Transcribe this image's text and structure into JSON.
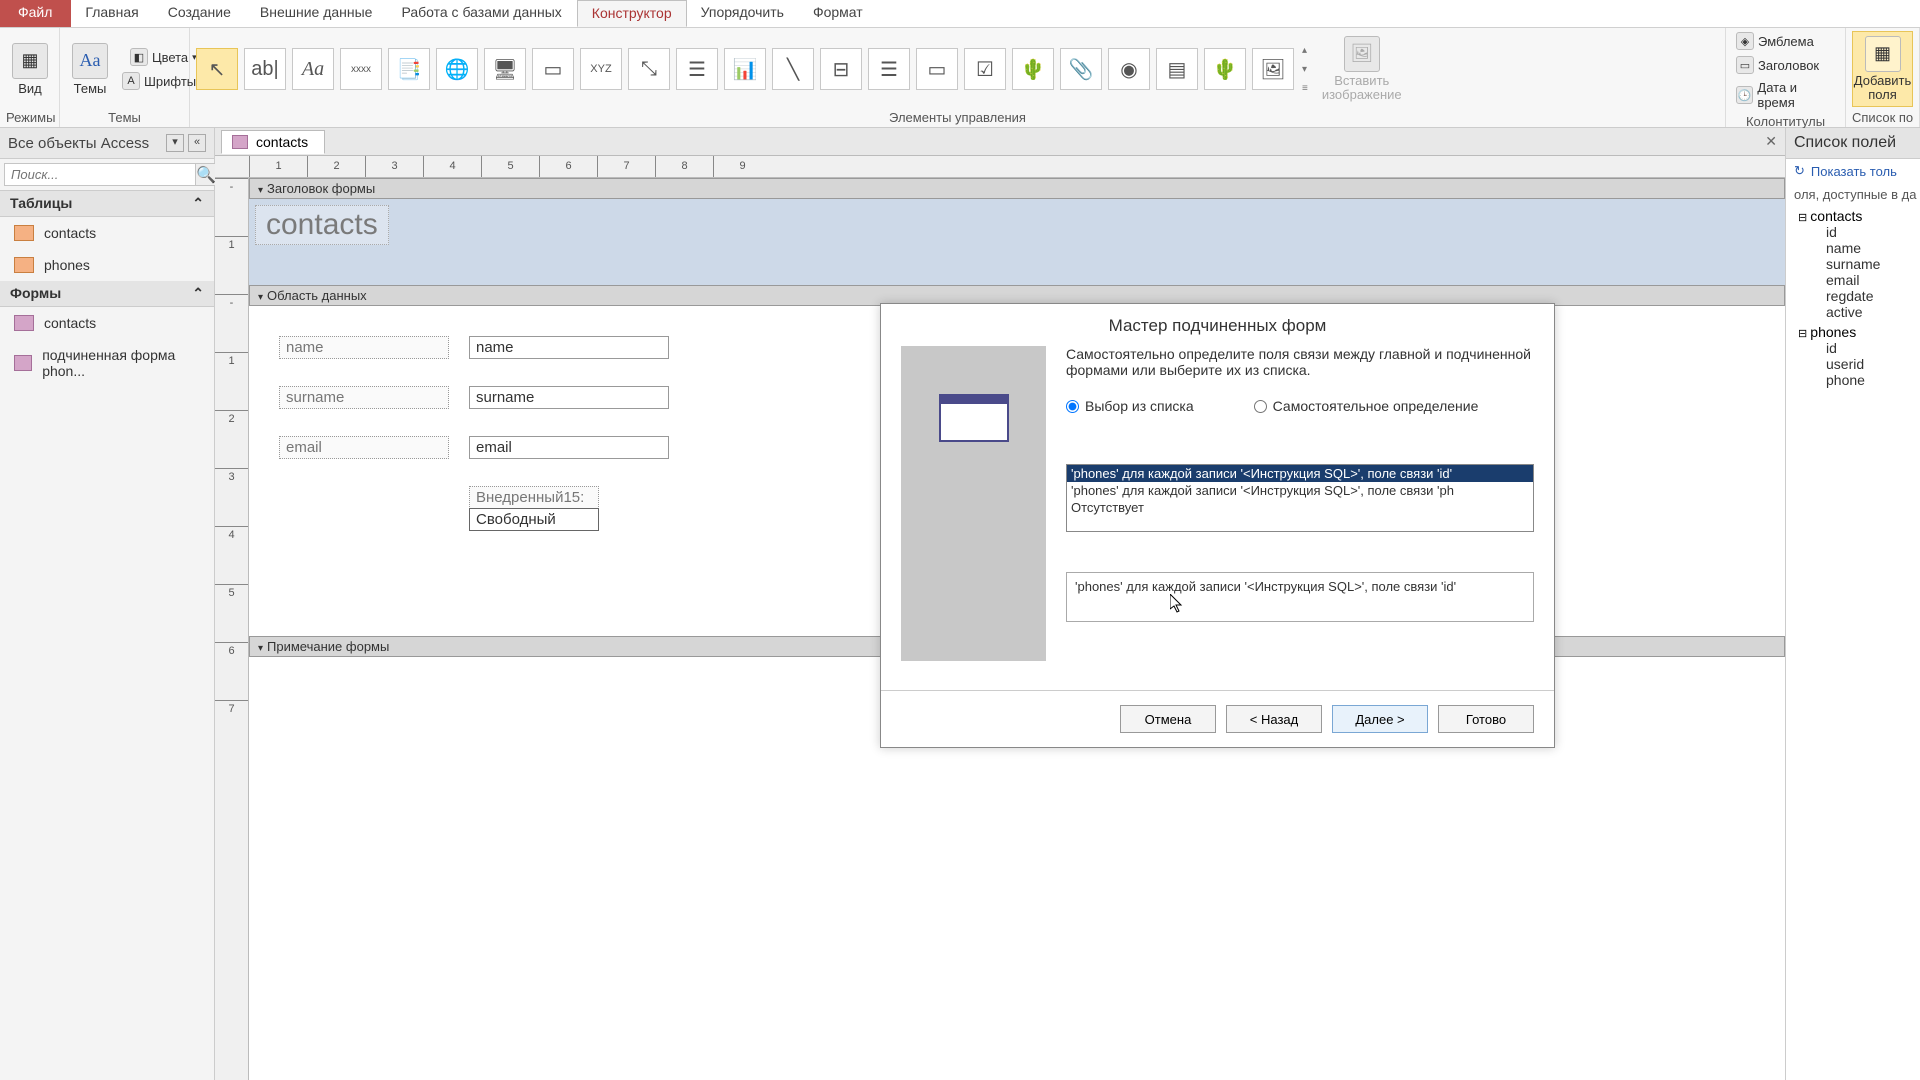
{
  "tabs": {
    "file": "Файл",
    "home": "Главная",
    "create": "Создание",
    "external": "Внешние данные",
    "dbtools": "Работа с базами данных",
    "design": "Конструктор",
    "arrange": "Упорядочить",
    "format": "Формат"
  },
  "ribbon": {
    "modes": {
      "view": "Вид",
      "label": "Режимы"
    },
    "themes": {
      "themes": "Темы",
      "colors": "Цвета",
      "fonts": "Шрифты",
      "label": "Темы"
    },
    "controls": {
      "label": "Элементы управления",
      "insert_image": "Вставить\nизображение"
    },
    "headerfooter": {
      "logo": "Эмблема",
      "title": "Заголовок",
      "datetime": "Дата и время",
      "label": "Колонтитулы"
    },
    "addfields": {
      "btn": "Добавить\nполя",
      "label": "Список полей"
    }
  },
  "nav": {
    "header": "Все объекты Access",
    "search_placeholder": "Поиск...",
    "cat_tables": "Таблицы",
    "cat_forms": "Формы",
    "t_contacts": "contacts",
    "t_phones": "phones",
    "f_contacts": "contacts",
    "f_subform": "подчиненная форма phon..."
  },
  "doc": {
    "tab": "contacts"
  },
  "form": {
    "section_header": "Заголовок формы",
    "section_detail": "Область данных",
    "section_footer": "Примечание формы",
    "title": "contacts",
    "lbl_name": "name",
    "fld_name": "name",
    "lbl_surname": "surname",
    "fld_surname": "surname",
    "lbl_email": "email",
    "fld_email": "email",
    "embed_label": "Внедренный15:",
    "embed_value": "Свободный"
  },
  "wizard": {
    "title": "Мастер подчиненных форм",
    "instruction": "Самостоятельно определите поля связи между главной и подчиненной формами или выберите их из списка.",
    "radio_list": "Выбор из списка",
    "radio_self": "Самостоятельное определение",
    "opt1": "'phones' для каждой записи '<Инструкция SQL>', поле связи 'id'",
    "opt2": "'phones' для каждой записи '<Инструкция SQL>', поле связи 'ph",
    "opt3": "Отсутствует",
    "result": "'phones' для каждой записи '<Инструкция SQL>', поле связи 'id'",
    "btn_cancel": "Отмена",
    "btn_back": "< Назад",
    "btn_next": "Далее >",
    "btn_finish": "Готово"
  },
  "fieldlist": {
    "header": "Список полей",
    "show_all": "Показать толь",
    "available": "оля, доступные в да",
    "t1": "contacts",
    "t1_fields": [
      "id",
      "name",
      "surname",
      "email",
      "regdate",
      "active"
    ],
    "t2": "phones",
    "t2_fields": [
      "id",
      "userid",
      "phone"
    ]
  },
  "ruler": [
    "1",
    "2",
    "3",
    "4",
    "5",
    "6",
    "7",
    "8",
    "9"
  ]
}
